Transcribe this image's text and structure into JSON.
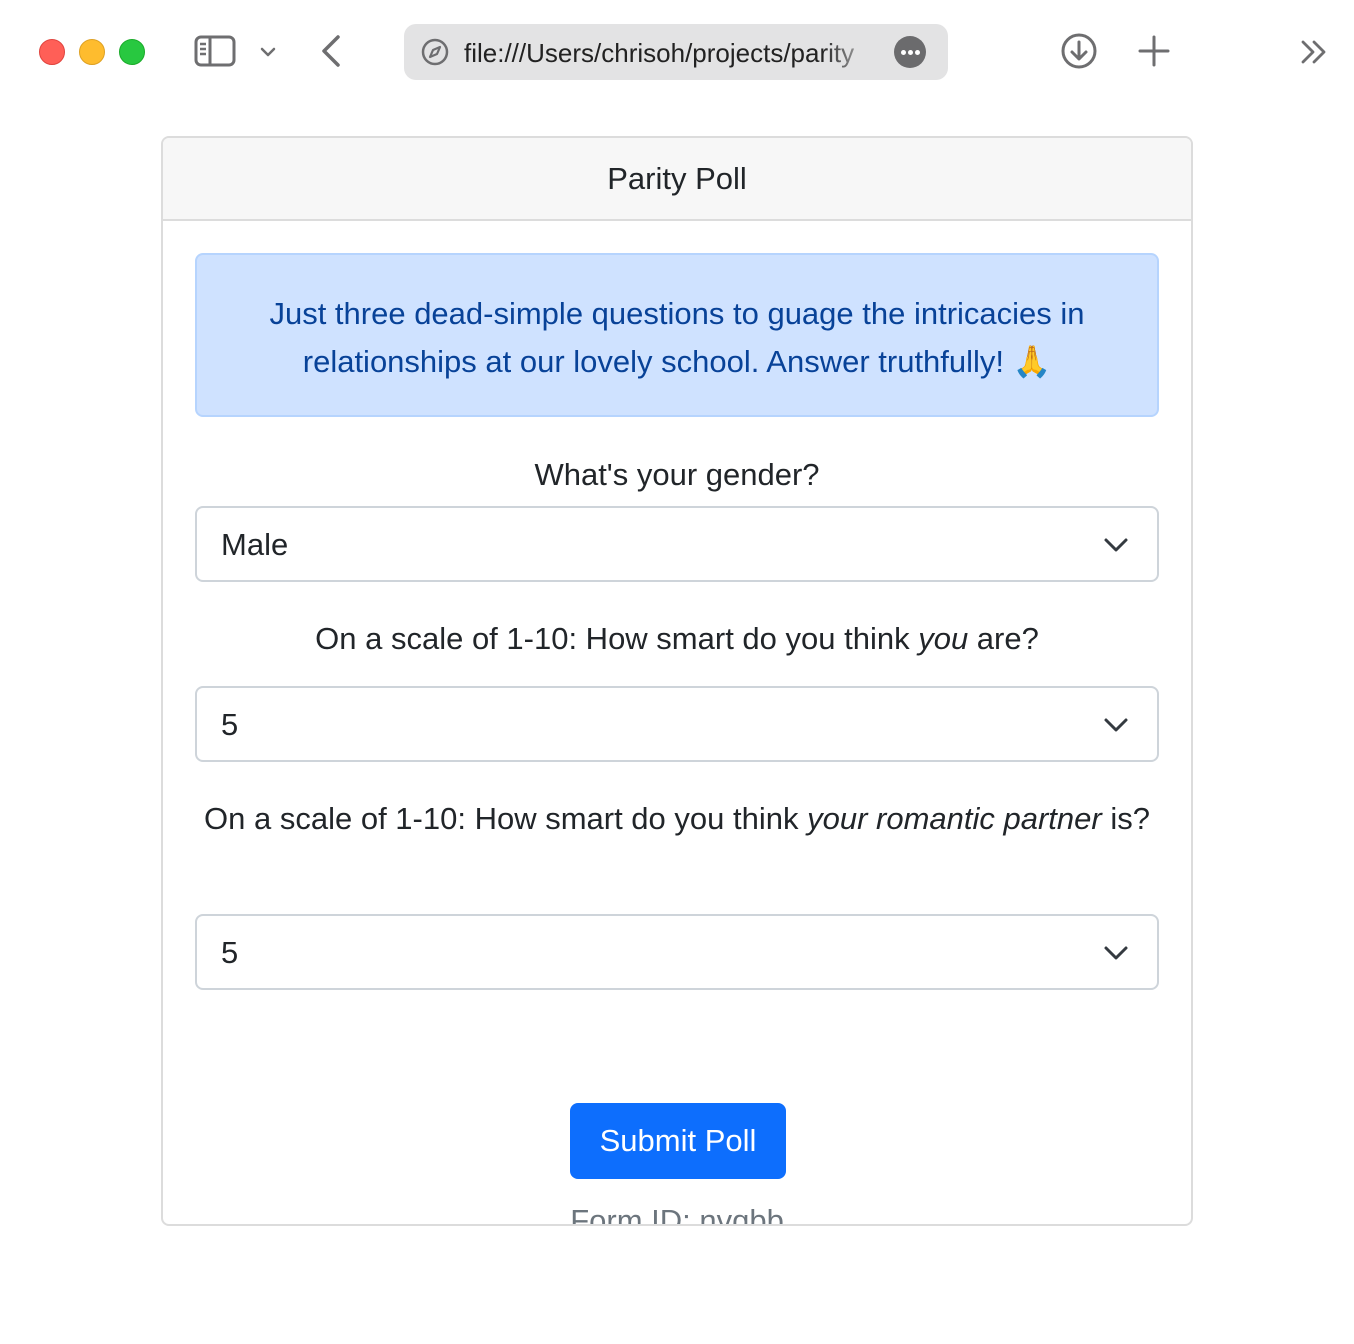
{
  "browser": {
    "url": "file:///Users/chrisoh/projects/parity"
  },
  "poll": {
    "title": "Parity Poll",
    "intro": "Just three dead-simple questions to guage the intricacies in relationships at our lovely school. Answer truthfully! 🙏",
    "questions": [
      {
        "label_before": "What's your gender?",
        "label_emph": "",
        "label_after": "",
        "selected": "Male"
      },
      {
        "label_before": "On a scale of 1-10: How smart do you think ",
        "label_emph": "you",
        "label_after": " are?",
        "selected": "5"
      },
      {
        "label_before": "On a scale of 1-10: How smart do you think ",
        "label_emph": "your romantic partner",
        "label_after": " is?",
        "selected": "5"
      }
    ],
    "submit_label": "Submit Poll",
    "form_id_label": "Form ID: nvqbb"
  },
  "colors": {
    "primary": "#0d6efd",
    "alert_bg": "#cfe2ff",
    "alert_text": "#084298",
    "muted": "#6c757d"
  },
  "icons": {
    "sidebar": "sidebar-icon",
    "back": "back-icon",
    "site": "compass-icon",
    "download": "download-icon",
    "new_tab": "plus-icon",
    "more": "double-chevron-icon"
  }
}
